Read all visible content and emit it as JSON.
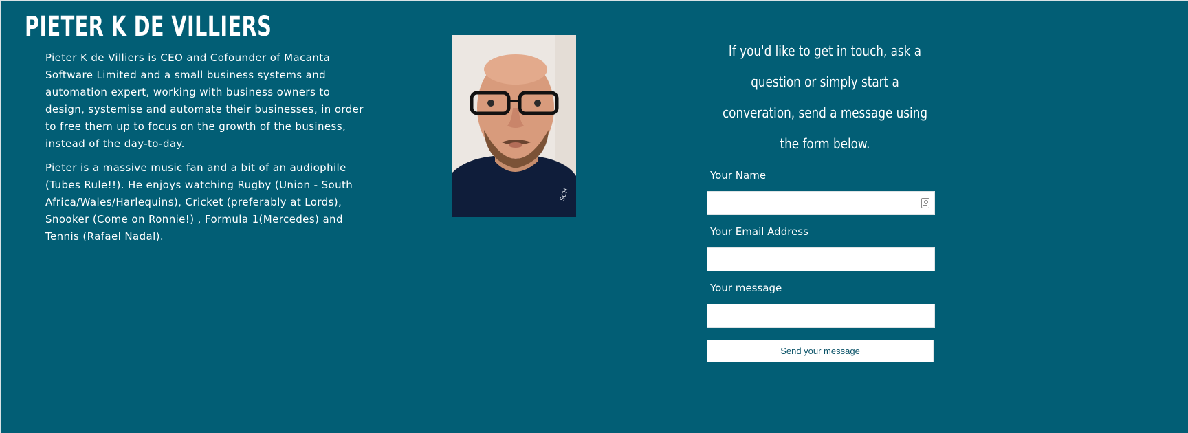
{
  "profile": {
    "name": "PIETER K DE VILLIERS",
    "bio": [
      "Pieter K de Villiers is CEO and Cofounder of Macanta Software Limited and a small business systems and automation expert, working with business owners to design, systemise and automate their businesses, in order to free them up to focus on the growth of the business, instead of the day-to-day.",
      "Pieter is a massive music fan and a bit of an audiophile (Tubes Rule!!). He enjoys watching Rugby (Union - South Africa/Wales/Harlequins), Cricket (preferably at Lords), Snooker (Come on Ronnie!) , Formula 1(Mercedes) and Tennis (Rafael Nadal)."
    ]
  },
  "contact": {
    "intro": "If you'd like to get in touch, ask a question or simply start a converation, send a message using the form below.",
    "fields": {
      "name_label": "Your Name",
      "name_value": "",
      "email_label": "Your Email Address",
      "email_value": "",
      "message_label": "Your message",
      "message_value": ""
    },
    "submit_label": "Send your message"
  },
  "colors": {
    "background": "#025e75",
    "text": "#ffffff",
    "button_text": "#0b5368"
  },
  "icons": {
    "name_field": "contact-card-icon"
  }
}
